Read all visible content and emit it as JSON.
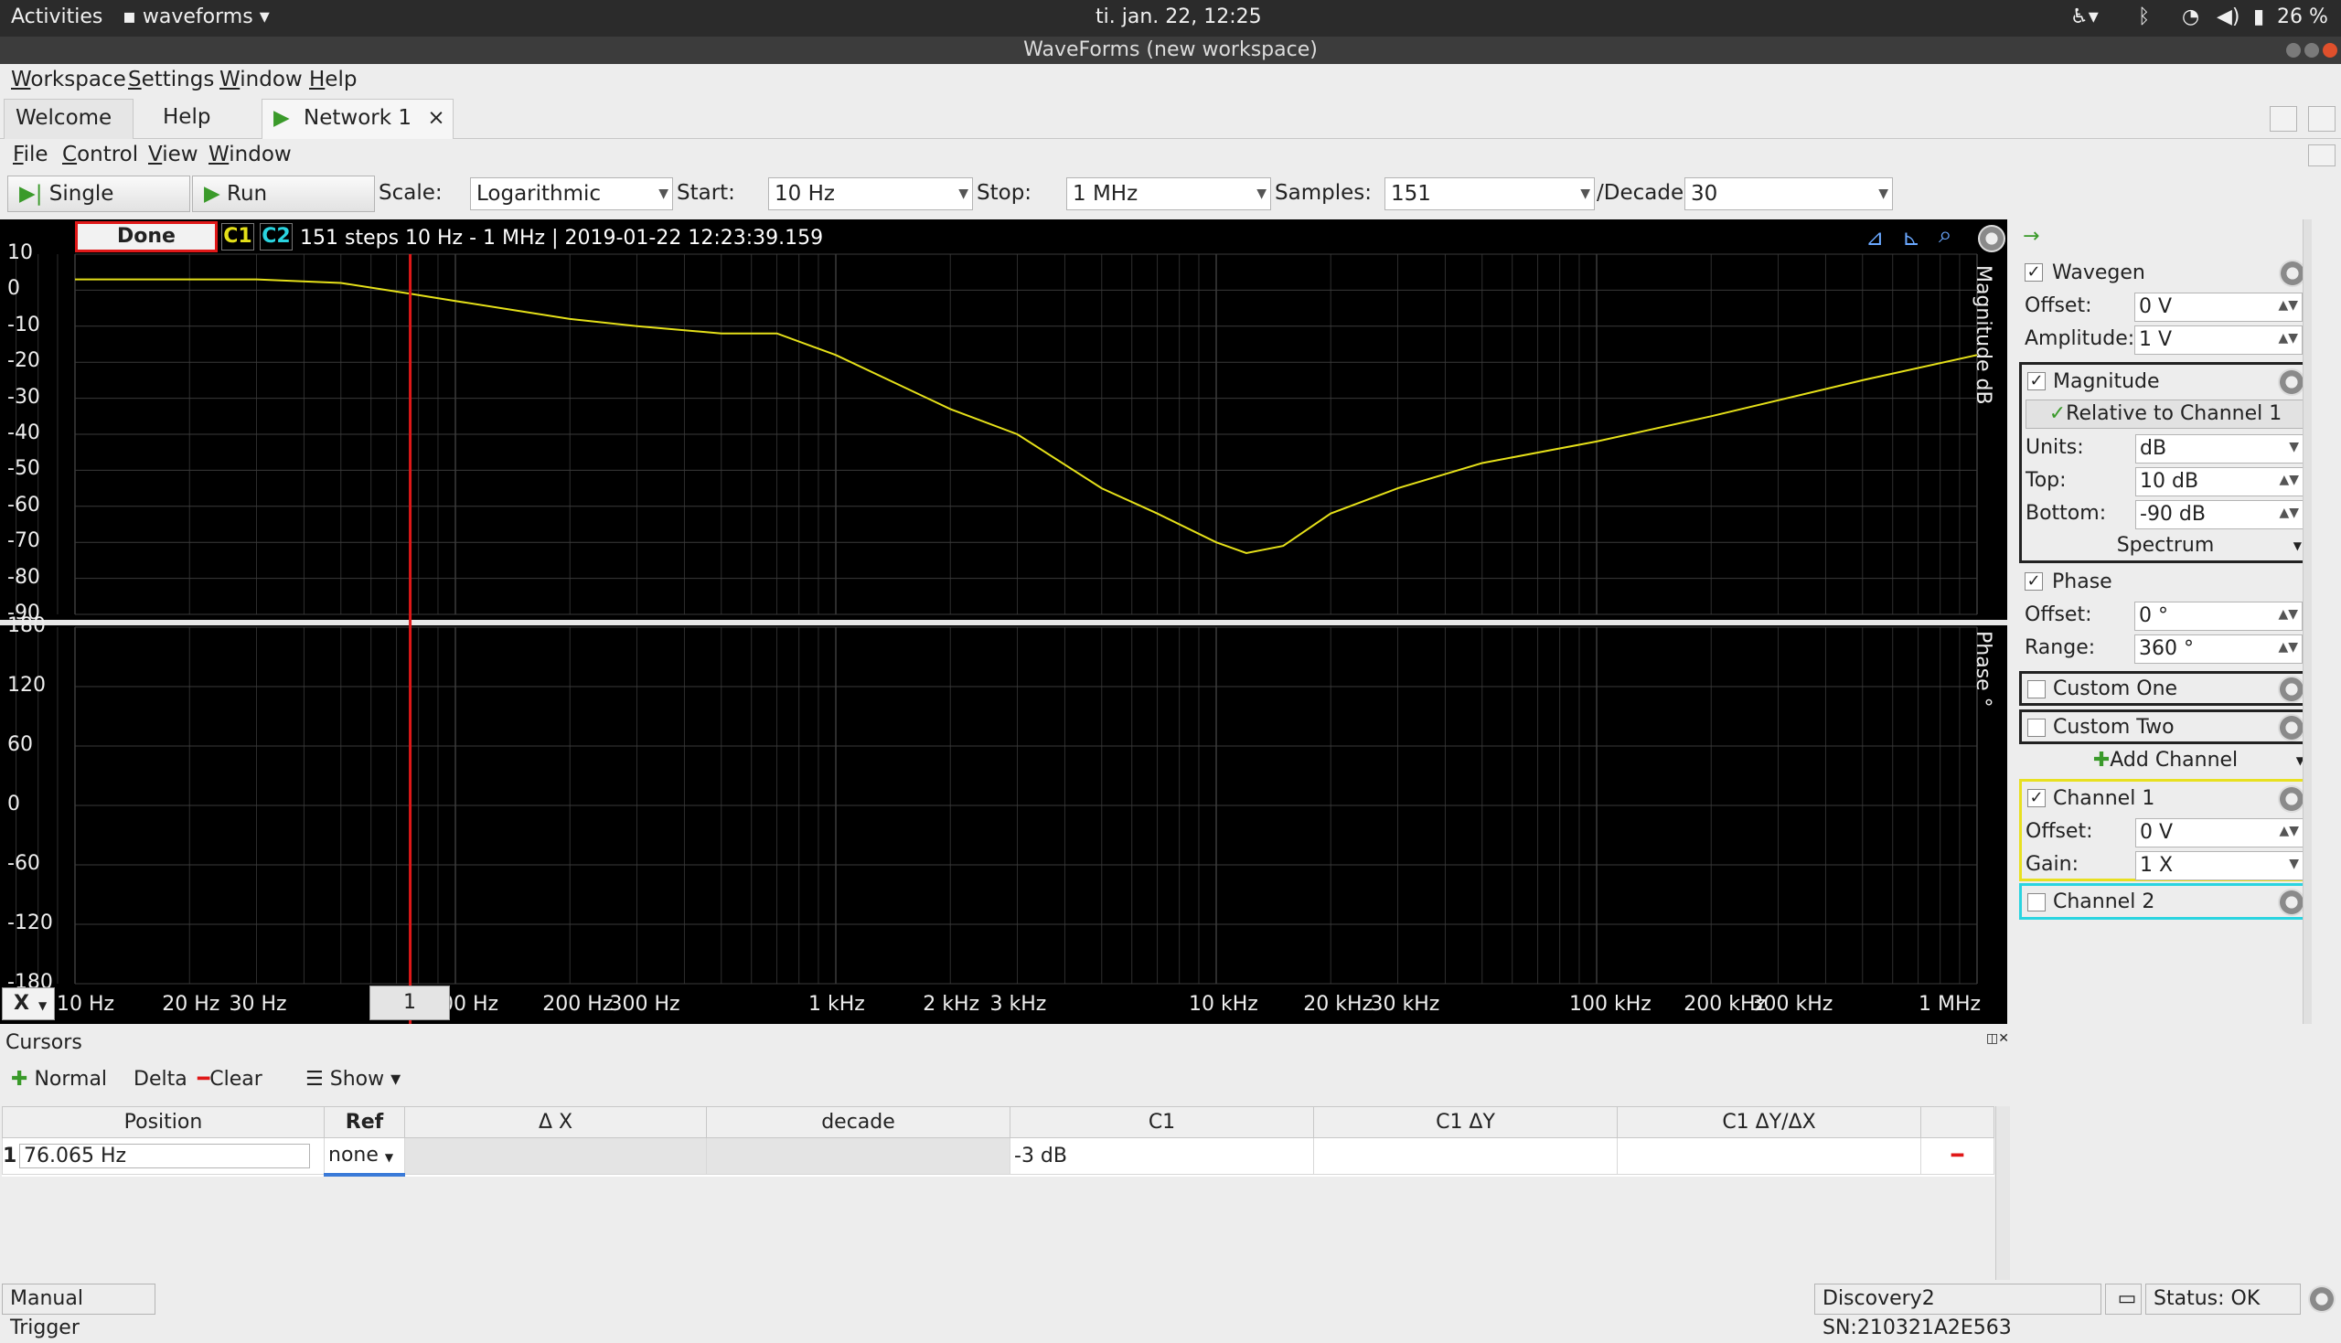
{
  "topbar": {
    "activities": "Activities",
    "app_menu": "waveforms",
    "clock": "ti. jan. 22, 12:25",
    "battery": "26 %"
  },
  "window": {
    "title": "WaveForms (new workspace)"
  },
  "main_menu": [
    "Workspace",
    "Settings",
    "Window",
    "Help"
  ],
  "tabs": {
    "welcome": "Welcome",
    "help": "Help",
    "network": "Network 1",
    "close": "×"
  },
  "sub_menu": [
    "File",
    "Control",
    "View",
    "Window"
  ],
  "toolbar": {
    "single_label": "Single",
    "run_label": "Run",
    "scale_label": "Scale:",
    "scale_value": "Logarithmic",
    "start_label": "Start:",
    "start_value": "10 Hz",
    "stop_label": "Stop:",
    "stop_value": "1 MHz",
    "samples_label": "Samples:",
    "samples_value": "151",
    "decade_label": "/Decade:",
    "decade_value": "30"
  },
  "plot": {
    "status": "Done",
    "c1": "C1",
    "c2": "C2",
    "info": "151 steps  10 Hz - 1 MHz | 2019-01-22 12:23:39.159",
    "magnitude_axis_title": "Magnitude dB",
    "phase_axis_title": "Phase °",
    "x_button": "X",
    "cursor_marker": "1",
    "colors": {
      "channel1": "#e5e019",
      "channel2": "#2ad4e0",
      "cursor": "#e01818"
    }
  },
  "chart_data": [
    {
      "type": "line",
      "ylabel": "Magnitude dB",
      "ylim": [
        -90,
        10
      ],
      "yticks": [
        "10",
        "0",
        "-10",
        "-20",
        "-30",
        "-40",
        "-50",
        "-60",
        "-70",
        "-80",
        "-90"
      ],
      "xscale": "log",
      "xlim": [
        10,
        1000000
      ],
      "xticks": [
        "10 Hz",
        "20 Hz",
        "30 Hz",
        "100 Hz",
        "200 Hz",
        "300 Hz",
        "1 kHz",
        "2 kHz",
        "3 kHz",
        "10 kHz",
        "20 kHz",
        "30 kHz",
        "100 kHz",
        "200 kHz",
        "300 kHz",
        "1 MHz"
      ],
      "grid": true,
      "series": [
        {
          "x": [
            10,
            20,
            30,
            50,
            76,
            100,
            200,
            300,
            500,
            700,
            1000,
            2000,
            3000,
            5000,
            7000,
            10000,
            12000,
            15000,
            20000,
            30000,
            50000,
            100000,
            200000,
            500000,
            1000000
          ],
          "y": [
            3,
            3,
            3,
            2,
            -1,
            -3,
            -8,
            -10,
            -12,
            -12,
            -18,
            -33,
            -40,
            -55,
            -62,
            -70,
            -73,
            -71,
            -62,
            -55,
            -48,
            -42,
            -35,
            -25,
            -18
          ]
        }
      ]
    },
    {
      "type": "line",
      "ylabel": "Phase °",
      "ylim": [
        -180,
        180
      ],
      "yticks": [
        "180",
        "120",
        "60",
        "0",
        "-60",
        "-120",
        "-180"
      ],
      "xscale": "log",
      "xlim": [
        10,
        1000000
      ],
      "grid": true,
      "series": []
    }
  ],
  "right_panel": {
    "wavegen": {
      "label": "Wavegen",
      "offset_label": "Offset:",
      "offset": "0 V",
      "amplitude_label": "Amplitude:",
      "amplitude": "1 V"
    },
    "magnitude": {
      "label": "Magnitude",
      "relative": "Relative to Channel 1",
      "units_label": "Units:",
      "units": "dB",
      "top_label": "Top:",
      "top": "10 dB",
      "bottom_label": "Bottom:",
      "bottom": "-90 dB",
      "spectrum": "Spectrum"
    },
    "phase": {
      "label": "Phase",
      "offset_label": "Offset:",
      "offset": "0 °",
      "range_label": "Range:",
      "range": "360 °"
    },
    "custom_one": "Custom One",
    "custom_two": "Custom Two",
    "add_channel": "Add Channel",
    "channel1": {
      "label": "Channel 1",
      "offset_label": "Offset:",
      "offset": "0 V",
      "gain_label": "Gain:",
      "gain": "1 X"
    },
    "channel2": {
      "label": "Channel 2"
    }
  },
  "cursors": {
    "title": "Cursors",
    "normal": "Normal",
    "delta": "Delta",
    "clear": "Clear",
    "show": "Show",
    "columns": [
      "Position",
      "Ref",
      "Δ X",
      "decade",
      "C1",
      "C1 ΔY",
      "C1 ΔY/ΔX"
    ],
    "row": {
      "index": "1",
      "position": "76.065 Hz",
      "ref": "none",
      "c1": "-3 dB"
    }
  },
  "statusbar": {
    "manual_trigger": "Manual Trigger",
    "device": "Discovery2 SN:210321A2E563",
    "status": "Status: OK"
  }
}
